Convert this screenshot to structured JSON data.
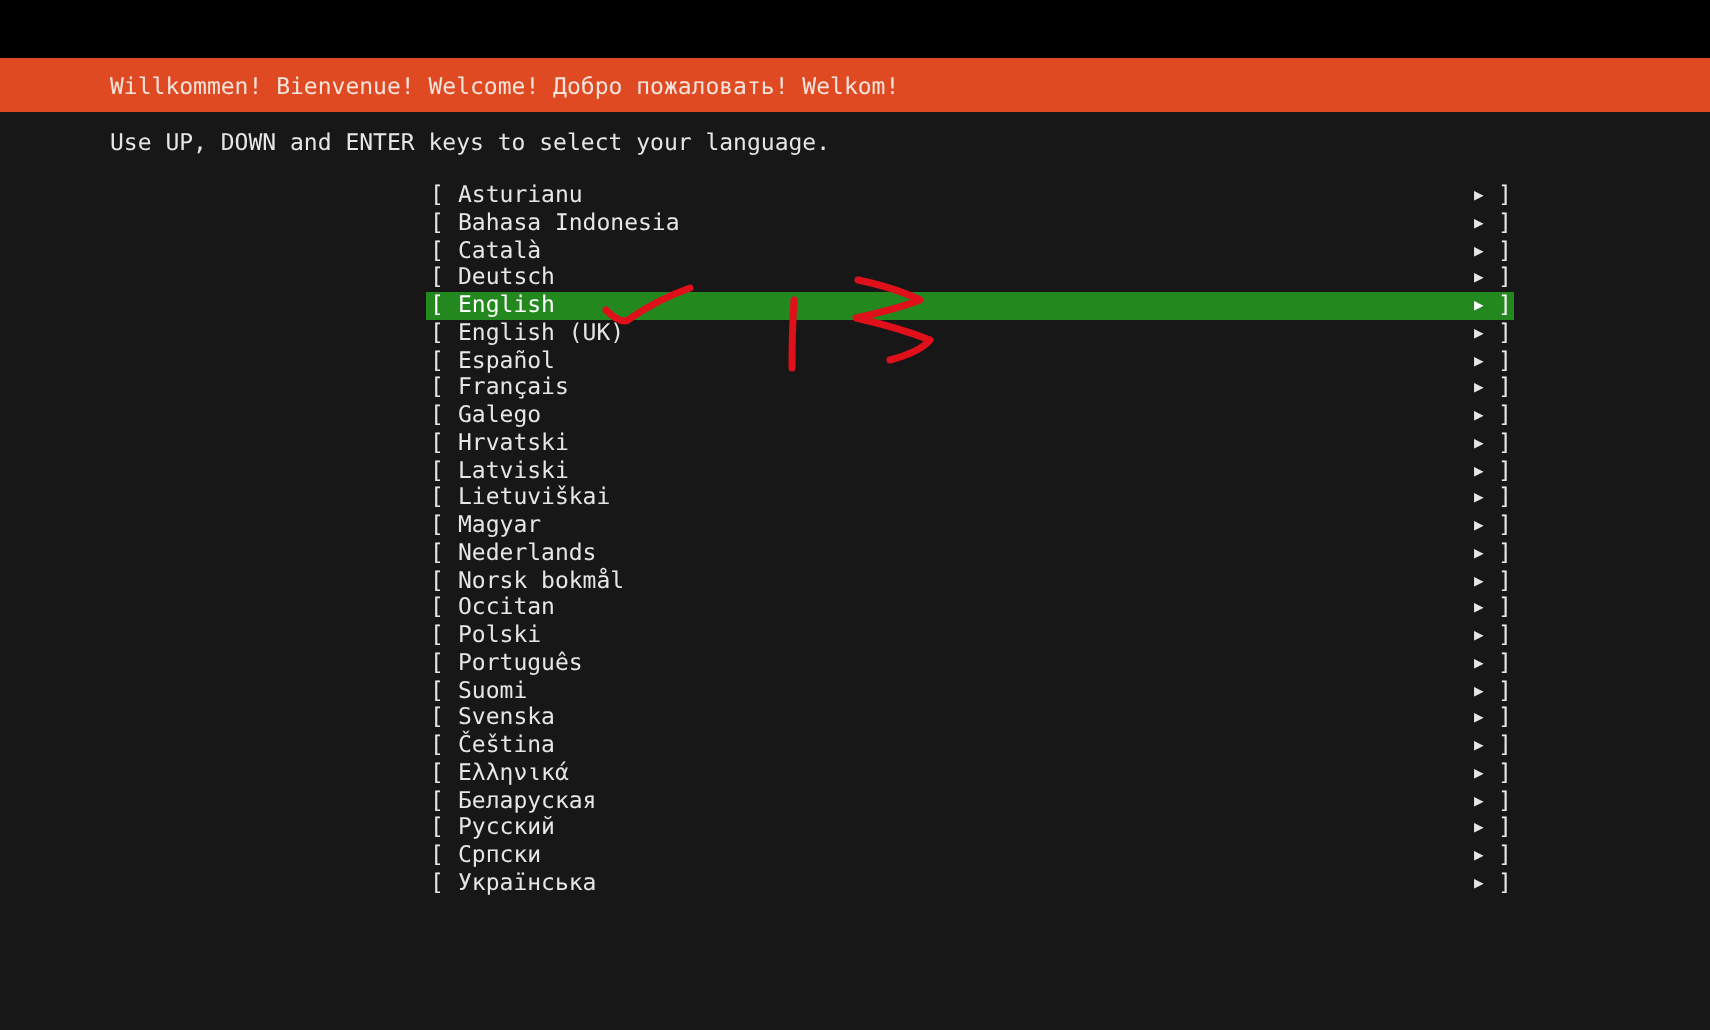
{
  "header": {
    "title": "Willkommen! Bienvenue! Welcome! Добро пожаловать! Welkom!"
  },
  "instruction": "Use UP, DOWN and ENTER keys to select your language.",
  "languages": [
    {
      "open": "[",
      "label": "Asturianu",
      "arrow": "▶",
      "close": "]",
      "selected": false
    },
    {
      "open": "[",
      "label": "Bahasa Indonesia",
      "arrow": "▶",
      "close": "]",
      "selected": false
    },
    {
      "open": "[",
      "label": "Català",
      "arrow": "▶",
      "close": "]",
      "selected": false
    },
    {
      "open": "[",
      "label": "Deutsch",
      "arrow": "▶",
      "close": "]",
      "selected": false
    },
    {
      "open": "[",
      "label": "English",
      "arrow": "▶",
      "close": "]",
      "selected": true
    },
    {
      "open": "[",
      "label": "English (UK)",
      "arrow": "▶",
      "close": "]",
      "selected": false
    },
    {
      "open": "[",
      "label": "Español",
      "arrow": "▶",
      "close": "]",
      "selected": false
    },
    {
      "open": "[",
      "label": "Français",
      "arrow": "▶",
      "close": "]",
      "selected": false
    },
    {
      "open": "[",
      "label": "Galego",
      "arrow": "▶",
      "close": "]",
      "selected": false
    },
    {
      "open": "[",
      "label": "Hrvatski",
      "arrow": "▶",
      "close": "]",
      "selected": false
    },
    {
      "open": "[",
      "label": "Latviski",
      "arrow": "▶",
      "close": "]",
      "selected": false
    },
    {
      "open": "[",
      "label": "Lietuviškai",
      "arrow": "▶",
      "close": "]",
      "selected": false
    },
    {
      "open": "[",
      "label": "Magyar",
      "arrow": "▶",
      "close": "]",
      "selected": false
    },
    {
      "open": "[",
      "label": "Nederlands",
      "arrow": "▶",
      "close": "]",
      "selected": false
    },
    {
      "open": "[",
      "label": "Norsk bokmål",
      "arrow": "▶",
      "close": "]",
      "selected": false
    },
    {
      "open": "[",
      "label": "Occitan",
      "arrow": "▶",
      "close": "]",
      "selected": false
    },
    {
      "open": "[",
      "label": "Polski",
      "arrow": "▶",
      "close": "]",
      "selected": false
    },
    {
      "open": "[",
      "label": "Português",
      "arrow": "▶",
      "close": "]",
      "selected": false
    },
    {
      "open": "[",
      "label": "Suomi",
      "arrow": "▶",
      "close": "]",
      "selected": false
    },
    {
      "open": "[",
      "label": "Svenska",
      "arrow": "▶",
      "close": "]",
      "selected": false
    },
    {
      "open": "[",
      "label": "Čeština",
      "arrow": "▶",
      "close": "]",
      "selected": false
    },
    {
      "open": "[",
      "label": "Ελληνικά",
      "arrow": "▶",
      "close": "]",
      "selected": false
    },
    {
      "open": "[",
      "label": "Беларуская",
      "arrow": "▶",
      "close": "]",
      "selected": false
    },
    {
      "open": "[",
      "label": "Русский",
      "arrow": "▶",
      "close": "]",
      "selected": false
    },
    {
      "open": "[",
      "label": "Српски",
      "arrow": "▶",
      "close": "]",
      "selected": false
    },
    {
      "open": "[",
      "label": "Українська",
      "arrow": "▶",
      "close": "]",
      "selected": false
    }
  ]
}
